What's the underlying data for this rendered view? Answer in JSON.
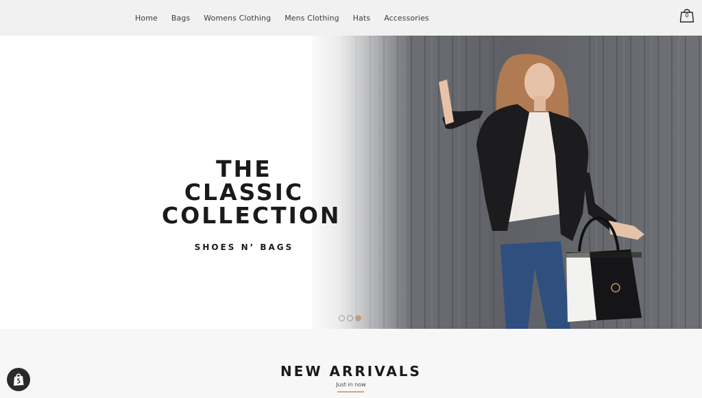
{
  "nav": {
    "items": [
      "Home",
      "Bags",
      "Womens Clothing",
      "Mens Clothing",
      "Hats",
      "Accessories"
    ]
  },
  "cart": {
    "count": "0",
    "icon": "shopping-bag-icon"
  },
  "hero": {
    "title": "THE CLASSIC\nCOLLECTION",
    "subtitle": "SHOES N’ BAGS",
    "slide_count": 3,
    "active_slide": 3
  },
  "arrivals": {
    "title": "NEW ARRIVALS",
    "subtitle": "Just in now"
  },
  "badge": {
    "icon": "shopify-bag-icon"
  },
  "colors": {
    "accent": "#c49a7a",
    "header_bg": "#f1f1f1",
    "text": "#1a1a1a"
  }
}
